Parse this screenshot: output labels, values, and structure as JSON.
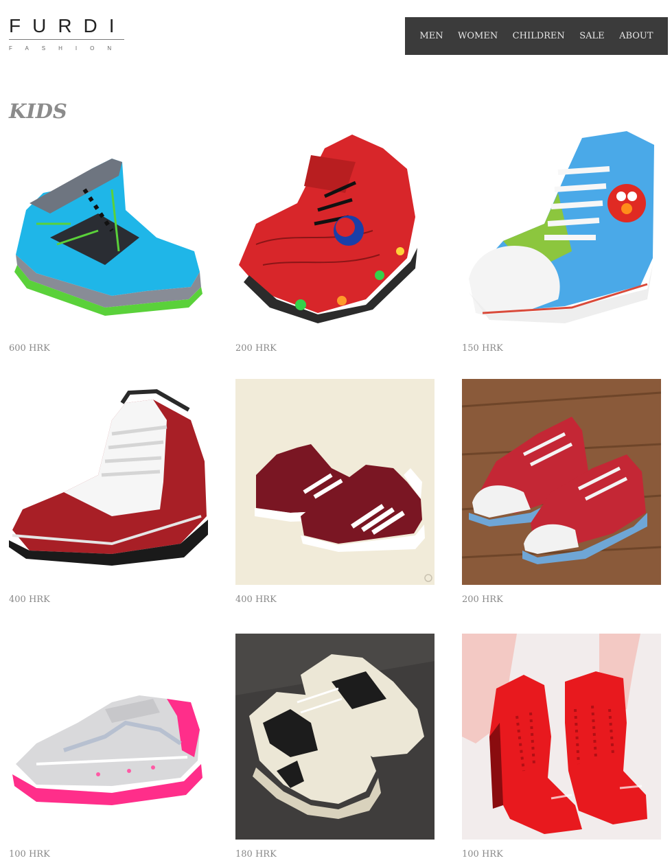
{
  "brand": {
    "name": "FURDI",
    "tagline": "FASHION"
  },
  "nav": {
    "items": [
      "MEN",
      "WOMEN",
      "CHILDREN",
      "SALE",
      "ABOUT"
    ]
  },
  "section": {
    "title": "KIDS"
  },
  "products": [
    {
      "price": "600 HRK"
    },
    {
      "price": "200 HRK"
    },
    {
      "price": "150 HRK"
    },
    {
      "price": "400 HRK"
    },
    {
      "price": "400 HRK"
    },
    {
      "price": "200 HRK"
    },
    {
      "price": "100 HRK"
    },
    {
      "price": "180 HRK"
    },
    {
      "price": "100 HRK"
    }
  ],
  "colors": {
    "nav_bg": "#3b3b3b",
    "nav_text": "#e6e6e6",
    "title": "#8b8b8b",
    "price": "#888888"
  }
}
